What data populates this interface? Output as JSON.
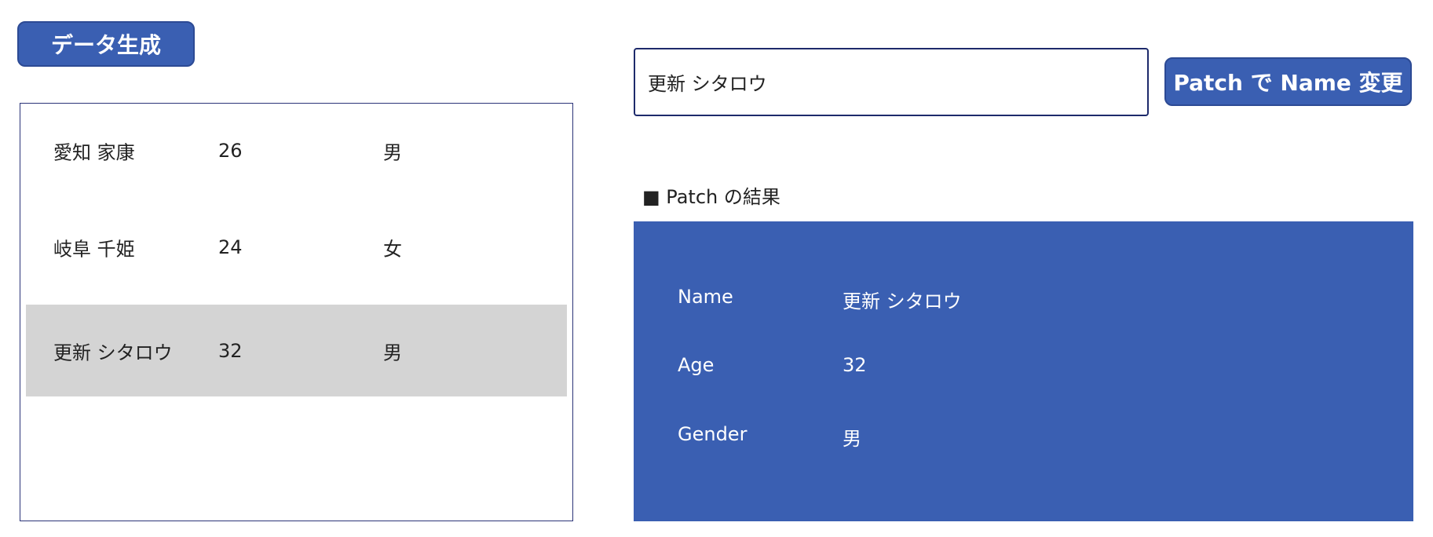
{
  "toolbar": {
    "generate_label": "データ生成",
    "patch_label": "Patch で Name 変更"
  },
  "name_input": {
    "value": "更新 シタロウ",
    "placeholder": ""
  },
  "gallery": {
    "rows": [
      {
        "name": "愛知 家康",
        "age": "26",
        "gender": "男",
        "selected": false
      },
      {
        "name": "岐阜 千姫",
        "age": "24",
        "gender": "女",
        "selected": false
      },
      {
        "name": "更新 シタロウ",
        "age": "32",
        "gender": "男",
        "selected": true
      }
    ]
  },
  "result": {
    "heading": "■ Patch の結果",
    "fields": [
      {
        "label": "Name",
        "value": "更新 シタロウ"
      },
      {
        "label": "Age",
        "value": "32"
      },
      {
        "label": "Gender",
        "value": "男"
      }
    ]
  },
  "colors": {
    "accent": "#3a5fb2",
    "selected_row": "#d4d4d4",
    "border": "#2b3478"
  }
}
